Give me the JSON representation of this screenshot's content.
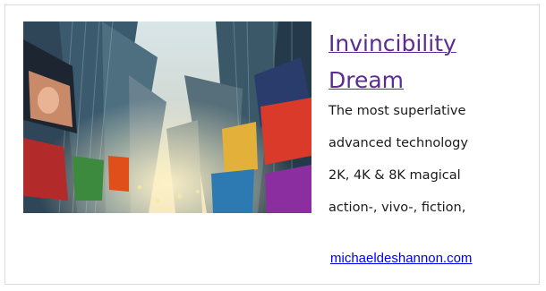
{
  "article": {
    "title_line1": "Invincibility",
    "title_line2": "Dream",
    "description": [
      "The most superlative",
      "advanced technology",
      "2K, 4K & 8K magical",
      "action-, vivo-, fiction,"
    ],
    "link": "michaeldeshannon.com"
  },
  "image": {
    "subject": "times-square-skyscrapers-upward-view"
  },
  "colors": {
    "title": "#5b2c91",
    "link": "#0000ee",
    "text": "#1a1a1a",
    "border": "#dcdcdc"
  }
}
